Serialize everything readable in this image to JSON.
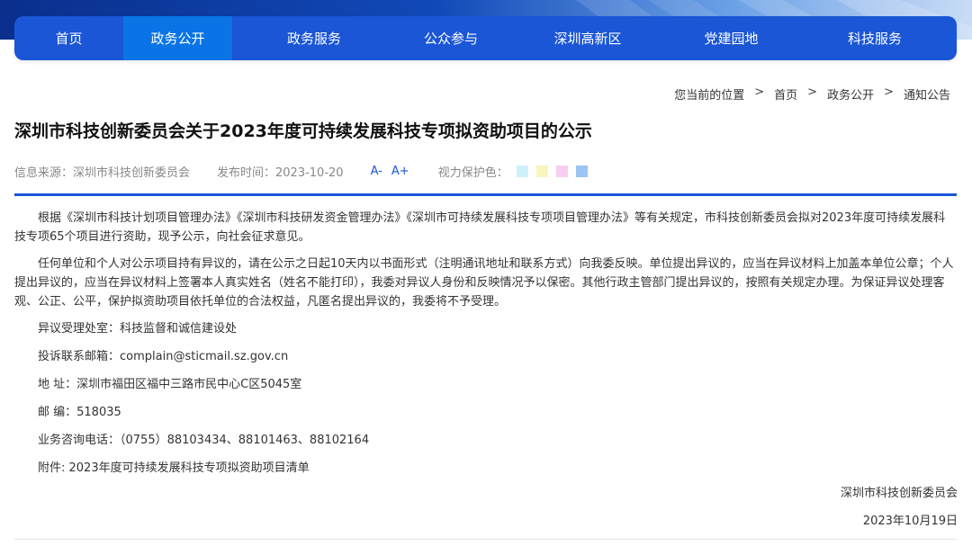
{
  "nav": {
    "items": [
      {
        "label": "首页"
      },
      {
        "label": "政务公开"
      },
      {
        "label": "政务服务"
      },
      {
        "label": "公众参与"
      },
      {
        "label": "深圳高新区"
      },
      {
        "label": "党建园地"
      },
      {
        "label": "科技服务"
      }
    ],
    "active_index": 1,
    "bar_color": "#1a56d6",
    "active_color": "#0a74e6"
  },
  "breadcrumb": {
    "prefix": "您当前的位置",
    "items": [
      "首页",
      "政务公开",
      "通知公告"
    ],
    "separator": ">"
  },
  "article": {
    "title": "深圳市科技创新委员会关于2023年度可持续发展科技专项拟资助项目的公示",
    "source_label": "信息来源：深圳市科技创新委员会",
    "date_label": "发布时间：2023-10-20",
    "font_smaller": "A-",
    "font_larger": "A+",
    "eye_care_label": "视力保护色：",
    "eye_care_colors": [
      "#cdf0fb",
      "#f8f5bd",
      "#f8cdf0",
      "#9cc4f4"
    ],
    "paragraphs": [
      "根据《深圳市科技计划项目管理办法》《深圳市科技研发资金管理办法》《深圳市可持续发展科技专项项目管理办法》等有关规定，市科技创新委员会拟对2023年度可持续发展科技专项65个项目进行资助，现予公示，向社会征求意见。",
      "任何单位和个人对公示项目持有异议的，请在公示之日起10天内以书面形式（注明通讯地址和联系方式）向我委反映。单位提出异议的，应当在异议材料上加盖本单位公章；个人提出异议的，应当在异议材料上签署本人真实姓名（姓名不能打印），我委对异议人身份和反映情况予以保密。其他行政主管部门提出异议的，按照有关规定办理。为保证异议处理客观、公正、公平，保护拟资助项目依托单位的合法权益，凡匿名提出异议的，我委将不予受理。"
    ],
    "contact_lines": [
      "异议受理处室：科技监督和诚信建设处",
      "投诉联系邮箱：complain@sticmail.sz.gov.cn",
      "地 址：深圳市福田区福中三路市民中心C区5045室",
      "邮 编：518035",
      "业务咨询电话：（0755）88103434、88101463、88102164",
      "附件: 2023年度可持续发展科技专项拟资助项目清单"
    ],
    "signature_org": "深圳市科技创新委员会",
    "signature_date": "2023年10月19日"
  },
  "colors": {
    "accent": "#1a56d6",
    "divider": "#1a56d6"
  }
}
